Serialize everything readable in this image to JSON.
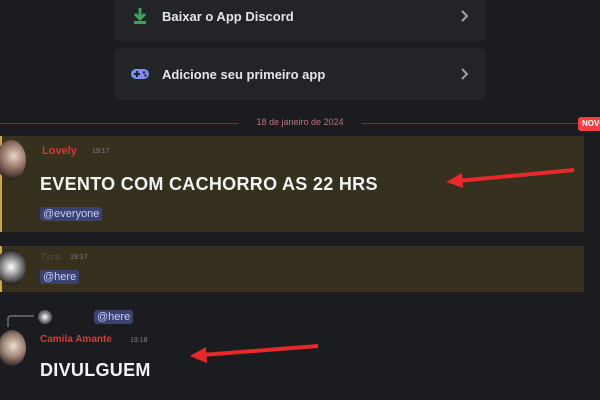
{
  "onboarding": {
    "items": [
      {
        "label": "Baixar o App Discord",
        "icon": "download-arrow-icon"
      },
      {
        "label": "Adicione seu primeiro app",
        "icon": "game-controller-icon"
      }
    ]
  },
  "divider": {
    "date": "18 de janeiro de 2024",
    "new_badge": "NOVO"
  },
  "messages": [
    {
      "author": "Lovely",
      "time": "19:17",
      "text": "EVENTO COM CACHORRO AS 22 HRS",
      "mention": "@everyone"
    },
    {
      "author": "Tyra",
      "time": "19:17",
      "mention": "@here"
    },
    {
      "reply_mention": "@here",
      "author": "Camila Amante",
      "time": "19:18",
      "text": "DIVULGUEM"
    }
  ],
  "colors": {
    "background": "#1b1c20",
    "highlight": "#36301f",
    "mention_bg": "#3c4270",
    "accent_red": "#e8282b",
    "username_red": "#d9363e"
  }
}
